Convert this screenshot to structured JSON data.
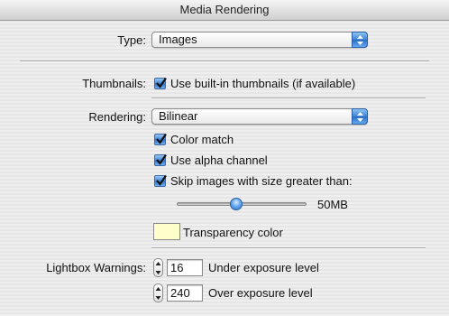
{
  "window": {
    "title": "Media Rendering"
  },
  "type_row": {
    "label": "Type:",
    "selected": "Images"
  },
  "thumbnails": {
    "label": "Thumbnails:",
    "checkbox_label": "Use built-in thumbnails (if available)",
    "checked": true
  },
  "rendering": {
    "label": "Rendering:",
    "selected": "Bilinear",
    "color_match": {
      "label": "Color match",
      "checked": true
    },
    "alpha": {
      "label": "Use alpha channel",
      "checked": true
    },
    "skip": {
      "label": "Skip images with size greater than:",
      "checked": true
    }
  },
  "size_slider": {
    "value_label": "50MB",
    "position_fraction": 0.46
  },
  "transparency": {
    "label": "Transparency color",
    "color": "#ffffcc"
  },
  "lightbox": {
    "label": "Lightbox Warnings:",
    "under": {
      "value": "16",
      "label": "Under exposure level"
    },
    "over": {
      "value": "240",
      "label": "Over exposure level"
    }
  },
  "colors": {
    "accent": "#3b82d6",
    "window_bg": "#ebebeb"
  },
  "icons": [
    "up-down-arrows-icon",
    "checkmark-icon",
    "stepper-arrows-icon"
  ]
}
